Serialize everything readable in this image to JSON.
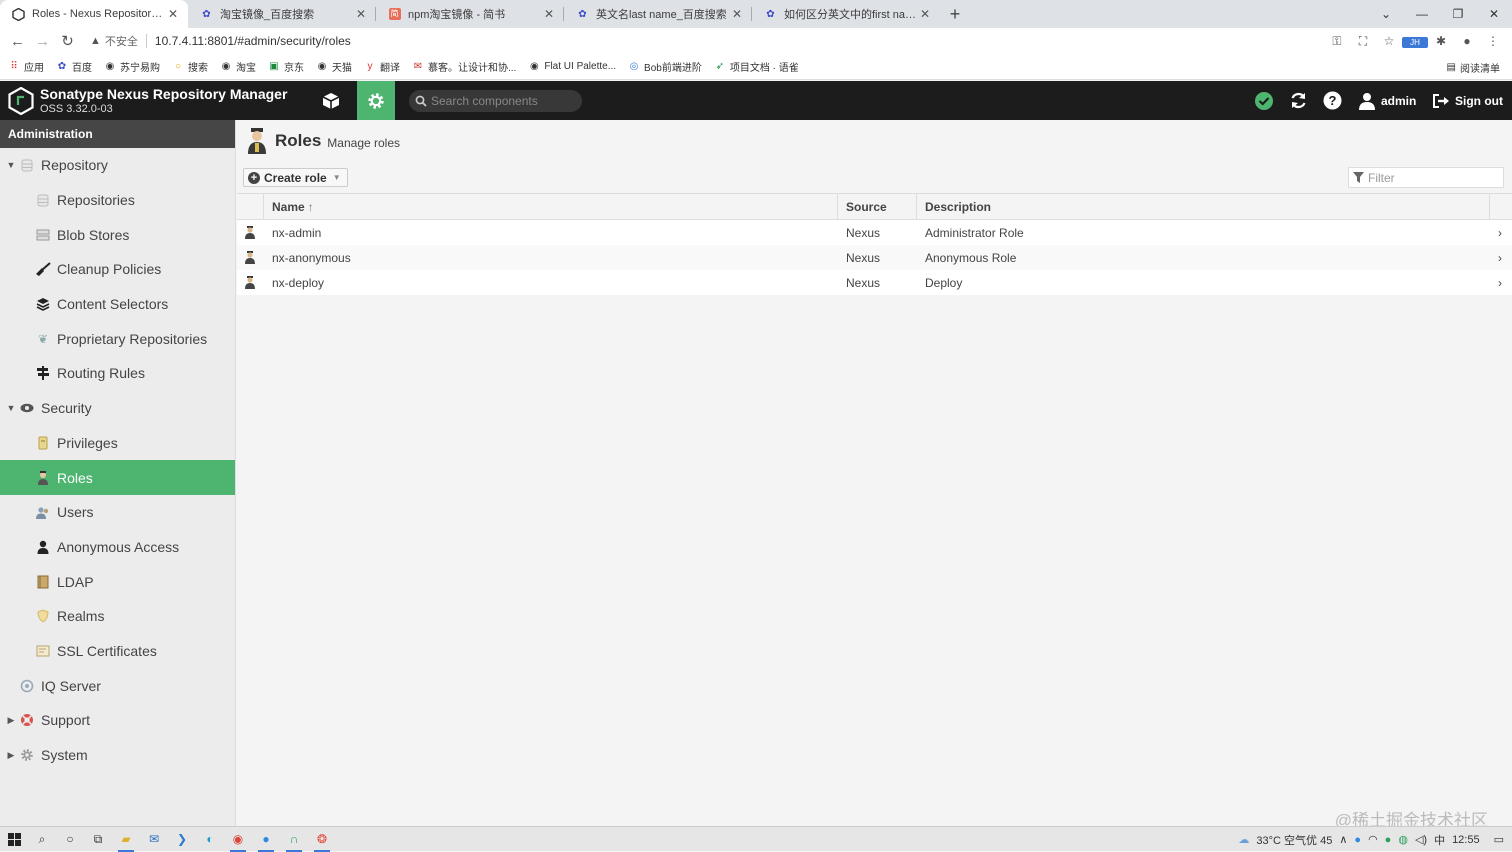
{
  "browser": {
    "tabs": [
      {
        "title": "Roles - Nexus Repository Manager",
        "active": true
      },
      {
        "title": "淘宝镜像_百度搜索",
        "active": false
      },
      {
        "title": "npm淘宝镜像 - 简书",
        "active": false
      },
      {
        "title": "英文名last name_百度搜索",
        "active": false
      },
      {
        "title": "如何区分英文中的first name和last name",
        "active": false
      }
    ],
    "insecure_label": "不安全",
    "url": "10.7.4.11:8801/#admin/security/roles",
    "bookmarks": [
      "应用",
      "百度",
      "苏宁易购",
      "搜索",
      "淘宝",
      "京东",
      "天猫",
      "翻译",
      "慕客。让设计和协...",
      "Flat UI Palette...",
      "Bob前端进阶",
      "项目文档 · 语雀"
    ],
    "reading_list": "阅读清单"
  },
  "header": {
    "product": "Sonatype Nexus Repository Manager",
    "version": "OSS 3.32.0-03",
    "search_placeholder": "Search components",
    "user": "admin",
    "signout": "Sign out",
    "accent": "#4db56f"
  },
  "sidebar": {
    "title": "Administration",
    "items": [
      {
        "label": "Repository",
        "level": 1,
        "expanded": true,
        "icon": "database-icon"
      },
      {
        "label": "Repositories",
        "level": 2,
        "icon": "database-icon"
      },
      {
        "label": "Blob Stores",
        "level": 2,
        "icon": "server-icon"
      },
      {
        "label": "Cleanup Policies",
        "level": 2,
        "icon": "broom-icon"
      },
      {
        "label": "Content Selectors",
        "level": 2,
        "icon": "layers-icon"
      },
      {
        "label": "Proprietary Repositories",
        "level": 2,
        "icon": "brain-icon"
      },
      {
        "label": "Routing Rules",
        "level": 2,
        "icon": "signpost-icon"
      },
      {
        "label": "Security",
        "level": 1,
        "expanded": true,
        "icon": "eye-icon"
      },
      {
        "label": "Privileges",
        "level": 2,
        "icon": "badge-icon"
      },
      {
        "label": "Roles",
        "level": 2,
        "icon": "role-icon",
        "selected": true
      },
      {
        "label": "Users",
        "level": 2,
        "icon": "users-icon"
      },
      {
        "label": "Anonymous Access",
        "level": 2,
        "icon": "user-icon"
      },
      {
        "label": "LDAP",
        "level": 2,
        "icon": "book-icon"
      },
      {
        "label": "Realms",
        "level": 2,
        "icon": "shield-icon"
      },
      {
        "label": "SSL Certificates",
        "level": 2,
        "icon": "certificate-icon"
      },
      {
        "label": "IQ Server",
        "level": 1,
        "icon": "iq-icon"
      },
      {
        "label": "Support",
        "level": 1,
        "collapsed": true,
        "icon": "lifebuoy-icon"
      },
      {
        "label": "System",
        "level": 1,
        "collapsed": true,
        "icon": "gear-icon"
      }
    ]
  },
  "page": {
    "title": "Roles",
    "subtitle": "Manage roles",
    "create_label": "Create role",
    "filter_placeholder": "Filter",
    "columns": [
      "Name",
      "Source",
      "Description"
    ],
    "rows": [
      {
        "name": "nx-admin",
        "source": "Nexus",
        "description": "Administrator Role"
      },
      {
        "name": "nx-anonymous",
        "source": "Nexus",
        "description": "Anonymous Role"
      },
      {
        "name": "nx-deploy",
        "source": "Nexus",
        "description": "Deploy"
      }
    ]
  },
  "watermark": "@稀土掘金技术社区",
  "taskbar": {
    "weather": "33°C 空气优 45",
    "time": "12:55"
  }
}
